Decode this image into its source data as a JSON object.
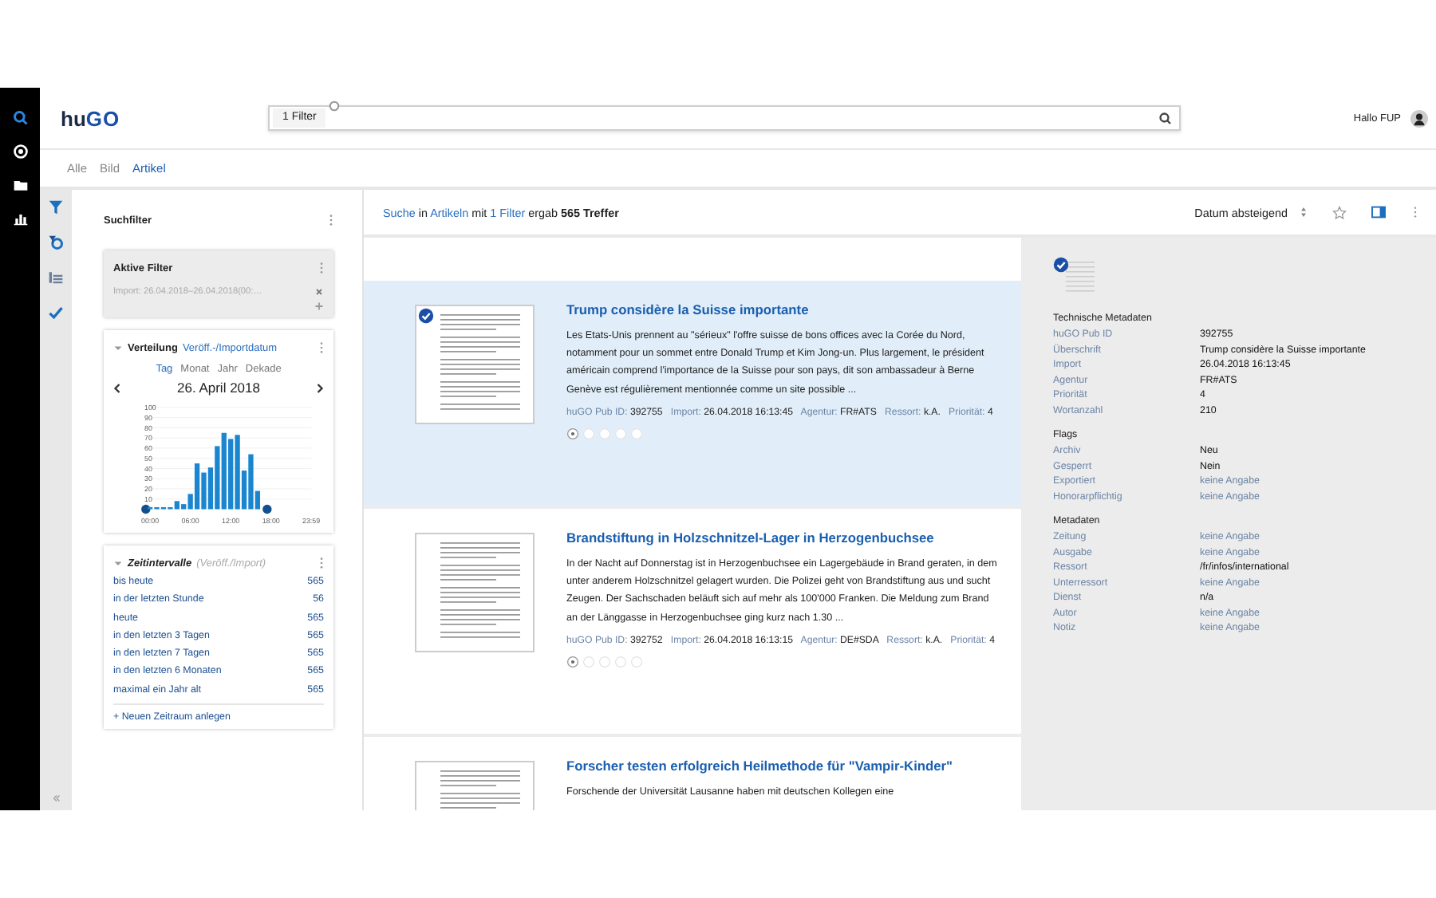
{
  "rail": [
    {
      "kind": "search",
      "selected": true
    },
    {
      "kind": "target",
      "selected": false
    },
    {
      "kind": "folder",
      "selected": false
    },
    {
      "kind": "chart",
      "selected": false
    }
  ],
  "header": {
    "logo": [
      "hu",
      "GO"
    ],
    "search": {
      "chip": "1 Filter"
    },
    "greeting": "Hallo FUP"
  },
  "tabs": [
    {
      "label": "Alle",
      "selected": false
    },
    {
      "label": "Bild",
      "selected": false
    },
    {
      "label": "Artikel",
      "selected": true
    }
  ],
  "filters": {
    "title": "Suchfilter",
    "active": {
      "title": "Aktive Filter",
      "items": [
        "Import: 26.04.2018–26.04.2018(00:…"
      ]
    },
    "distribution": {
      "title": "Verteilung",
      "link": "Veröff.-/Importdatum",
      "modes": [
        {
          "label": "Tag",
          "selected": true
        },
        {
          "label": "Monat",
          "selected": false
        },
        {
          "label": "Jahr",
          "selected": false
        },
        {
          "label": "Dekade",
          "selected": false
        }
      ],
      "date": "26. April 2018",
      "chart_data": {
        "type": "bar",
        "grid": true,
        "x": [
          0,
          1,
          2,
          3,
          4,
          5,
          6,
          7,
          8,
          9,
          10,
          11,
          12,
          13,
          14,
          15,
          16
        ],
        "series": [
          {
            "color": "#1a86d0",
            "values": [
              2,
              2,
              2,
              2,
              8,
              5,
              15,
              45,
              36,
              41,
              62,
              75,
              69,
              73,
              38,
              54,
              18
            ]
          }
        ],
        "xlim": [
          0,
          24
        ],
        "ylim": [
          0,
          100
        ],
        "xticks": [
          {
            "value": 0,
            "label": "00:00"
          },
          {
            "value": 6,
            "label": "06:00"
          },
          {
            "value": 12,
            "label": "12:00"
          },
          {
            "value": 18,
            "label": "18:00"
          },
          {
            "value": 23.98,
            "label": "23:59"
          }
        ],
        "yticks": [
          10,
          20,
          30,
          40,
          50,
          60,
          70,
          80,
          90,
          100
        ]
      }
    },
    "intervals": {
      "title": "Zeitintervalle",
      "subtitle": "(Veröff./Import)",
      "items": [
        {
          "label": "bis heute",
          "count": "565"
        },
        {
          "label": "in der letzten Stunde",
          "count": "56"
        },
        {
          "label": "heute",
          "count": "565"
        },
        {
          "label": "in den letzten 3 Tagen",
          "count": "565"
        },
        {
          "label": "in den letzten 7 Tagen",
          "count": "565"
        },
        {
          "label": "in den letzten 6 Monaten",
          "count": "565"
        },
        {
          "label": "maximal ein Jahr alt",
          "count": "565"
        }
      ],
      "add": "+ Neuen Zeitraum anlegen"
    }
  },
  "summary": [
    {
      "kind": "link",
      "text": "Suche"
    },
    {
      "kind": "plain",
      "text": "in"
    },
    {
      "kind": "link",
      "text": "Artikeln"
    },
    {
      "kind": "plain",
      "text": "mit"
    },
    {
      "kind": "link",
      "text": "1 Filter"
    },
    {
      "kind": "plain",
      "text": "ergab"
    },
    {
      "kind": "bold",
      "text": "565 Treffer"
    }
  ],
  "sort": "Datum absteigend",
  "articles": [
    {
      "selected": true,
      "title": "Trump considère la Suisse importante",
      "snippet": "Les Etats-Unis prennent au \"sérieux\" l'offre suisse de bons offices avec la Corée du Nord, notamment pour un sommet entre Donald Trump et Kim Jong-un. Plus largement, le président américain comprend l'importance de la Suisse pour son pays, dit son ambassadeur à Berne Genève est régulièrement mentionnée comme un site possible ...",
      "meta": [
        {
          "label": "huGO Pub ID:",
          "value": "392755"
        },
        {
          "label": "Import:",
          "value": "26.04.2018 16:13:45"
        },
        {
          "label": "Agentur:",
          "value": "FR#ATS"
        },
        {
          "label": "Ressort:",
          "value": "k.A."
        },
        {
          "label": "Priorität:",
          "value": "4"
        }
      ]
    },
    {
      "selected": false,
      "title": "Brandstiftung in Holzschnitzel-Lager in Herzogenbuchsee",
      "snippet": "In der Nacht auf Donnerstag ist in Herzogenbuchsee ein Lagergebäude in Brand geraten, in dem unter anderem Holzschnitzel gelagert wurden. Die Polizei geht von Brandstiftung aus und sucht Zeugen. Der Sachschaden beläuft sich auf mehr als 100'000 Franken. Die Meldung zum Brand an der Länggasse in Herzogenbuchsee ging kurz nach 1.30 ...",
      "meta": [
        {
          "label": "huGO Pub ID:",
          "value": "392752"
        },
        {
          "label": "Import:",
          "value": "26.04.2018 16:13:15"
        },
        {
          "label": "Agentur:",
          "value": "DE#SDA"
        },
        {
          "label": "Ressort:",
          "value": "k.A."
        },
        {
          "label": "Priorität:",
          "value": "4"
        }
      ]
    },
    {
      "selected": false,
      "title": "Forscher testen erfolgreich Heilmethode für \"Vampir-Kinder\"",
      "snippet": "Forschende der Universität Lausanne haben mit deutschen Kollegen eine"
    }
  ],
  "detail": {
    "sections": [
      {
        "title": "Technische Metadaten",
        "rows": [
          {
            "label": "huGO Pub ID",
            "value": "392755",
            "muted": false
          },
          {
            "label": "Überschrift",
            "value": "Trump considère la Suisse importante",
            "muted": false
          },
          {
            "label": "Import",
            "value": "26.04.2018 16:13:45",
            "muted": false
          },
          {
            "label": "Agentur",
            "value": "FR#ATS",
            "muted": false
          },
          {
            "label": "Priorität",
            "value": "4",
            "muted": false
          },
          {
            "label": "Wortanzahl",
            "value": "210",
            "muted": false
          }
        ]
      },
      {
        "title": "Flags",
        "rows": [
          {
            "label": "Archiv",
            "value": "Neu",
            "muted": false
          },
          {
            "label": "Gesperrt",
            "value": "Nein",
            "muted": false
          },
          {
            "label": "Exportiert",
            "value": "keine Angabe",
            "muted": true
          },
          {
            "label": "Honorarpflichtig",
            "value": "keine Angabe",
            "muted": true
          }
        ]
      },
      {
        "title": "Metadaten",
        "rows": [
          {
            "label": "Zeitung",
            "value": "keine Angabe",
            "muted": true
          },
          {
            "label": "Ausgabe",
            "value": "keine Angabe",
            "muted": true
          },
          {
            "label": "Ressort",
            "value": "/fr/infos/international",
            "muted": false
          },
          {
            "label": "Unterressort",
            "value": "keine Angabe",
            "muted": true
          },
          {
            "label": "Dienst",
            "value": "n/a",
            "muted": false
          },
          {
            "label": "Autor",
            "value": "keine Angabe",
            "muted": true
          },
          {
            "label": "Notiz",
            "value": "keine Angabe",
            "muted": true
          }
        ]
      }
    ]
  }
}
